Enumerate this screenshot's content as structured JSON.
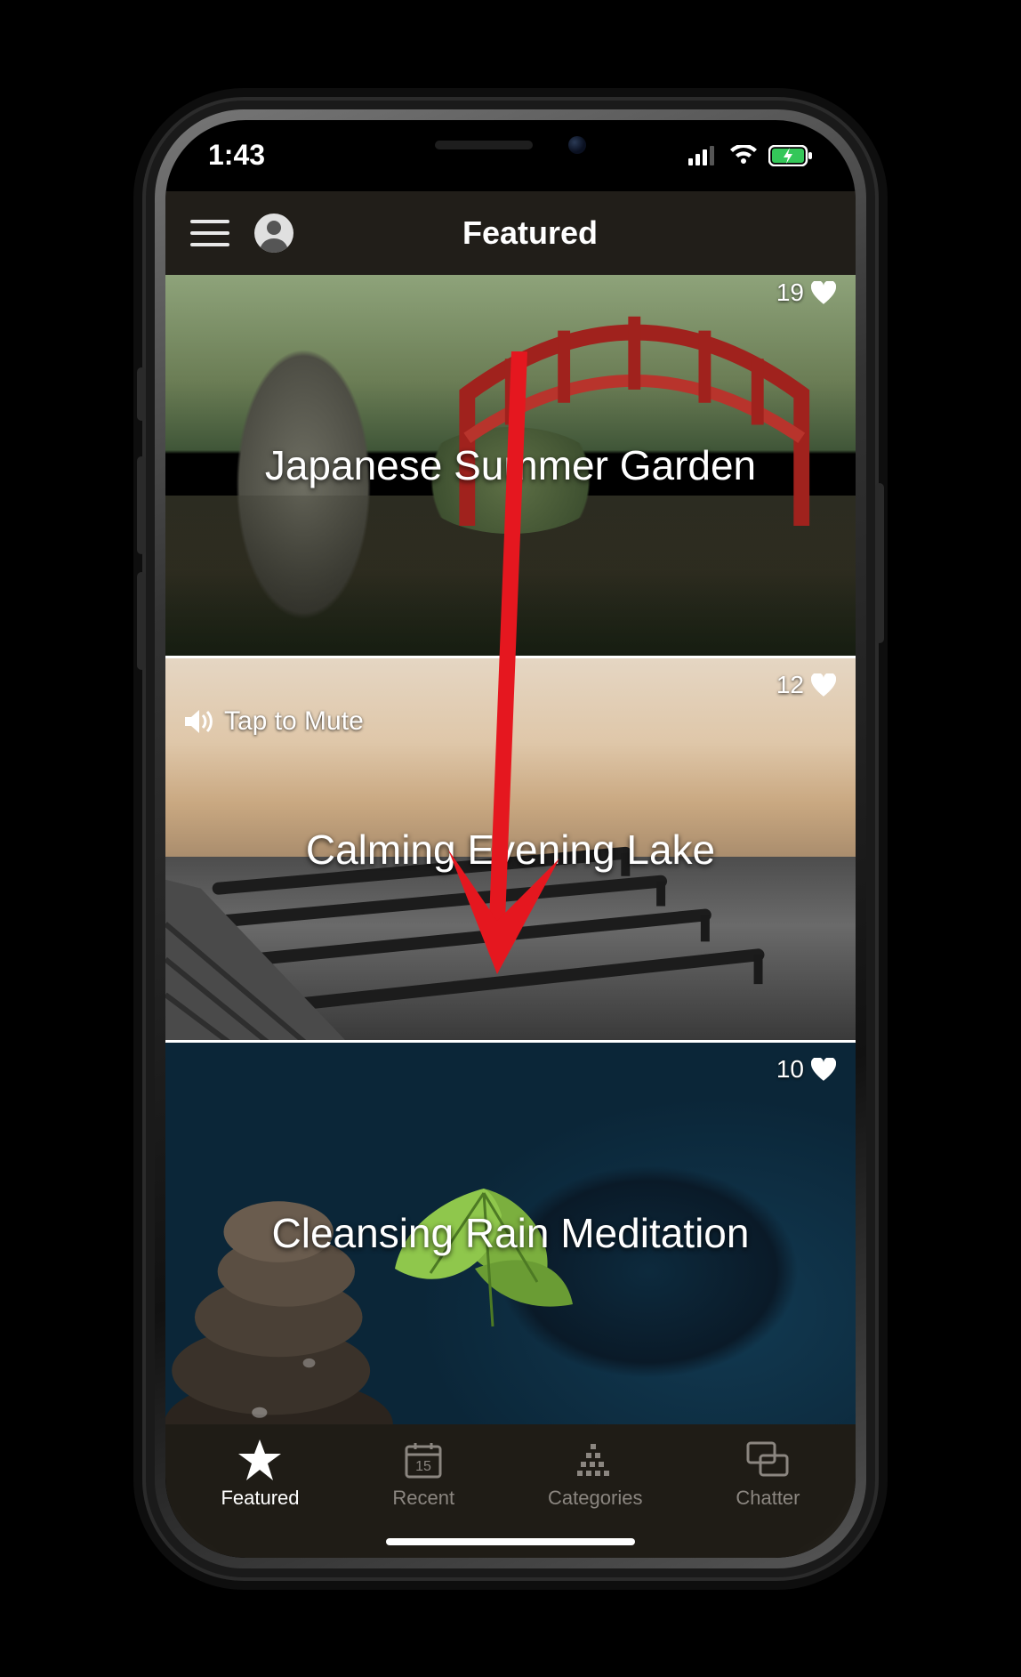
{
  "status": {
    "time": "1:43"
  },
  "nav": {
    "title": "Featured"
  },
  "cards": [
    {
      "title": "Japanese Summer Garden",
      "likes": "19"
    },
    {
      "title": "Calming Evening Lake",
      "likes": "12",
      "mute_hint": "Tap to Mute"
    },
    {
      "title": "Cleansing Rain Meditation",
      "likes": "10"
    }
  ],
  "tabs": [
    {
      "label": "Featured",
      "icon": "star",
      "active": true
    },
    {
      "label": "Recent",
      "icon": "calendar",
      "active": false,
      "badge": "15"
    },
    {
      "label": "Categories",
      "icon": "grid",
      "active": false
    },
    {
      "label": "Chatter",
      "icon": "chat",
      "active": false
    }
  ],
  "annotation": {
    "type": "arrow-down",
    "color": "#e5171f"
  }
}
